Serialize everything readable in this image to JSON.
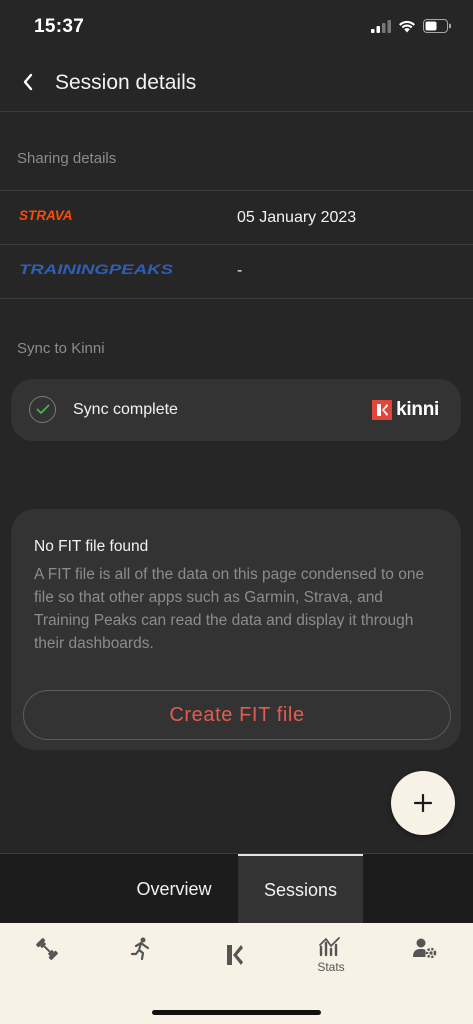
{
  "status_bar": {
    "time": "15:37"
  },
  "header": {
    "title": "Session details"
  },
  "sharing": {
    "label": "Sharing details",
    "items": [
      {
        "service": "STRAVA",
        "value": "05 January 2023",
        "color": "#fc4c02"
      },
      {
        "service": "TRAININGPEAKS",
        "value": "-",
        "color": "#1f4b9b"
      }
    ]
  },
  "sync": {
    "label": "Sync to Kinni",
    "status": "Sync complete",
    "brand": "kinni",
    "brand_color": "#e0473a"
  },
  "fit": {
    "title": "No FIT file found",
    "description": "A FIT file is all of the data on this page condensed to one file so that other apps such as Garmin, Strava, and Training Peaks can read the data and display it through their dashboards.",
    "button": "Create FIT file"
  },
  "tabs": {
    "overview": "Overview",
    "sessions": "Sessions",
    "active": "Sessions"
  },
  "bottom_nav": [
    {
      "icon": "dumbbell-icon",
      "label": ""
    },
    {
      "icon": "runner-icon",
      "label": ""
    },
    {
      "icon": "kinni-icon",
      "label": ""
    },
    {
      "icon": "stats-icon",
      "label": "Stats"
    },
    {
      "icon": "user-settings-icon",
      "label": ""
    }
  ],
  "colors": {
    "background": "#262626",
    "accent": "#e25c4f",
    "nav_bg": "#f7f1e6"
  }
}
